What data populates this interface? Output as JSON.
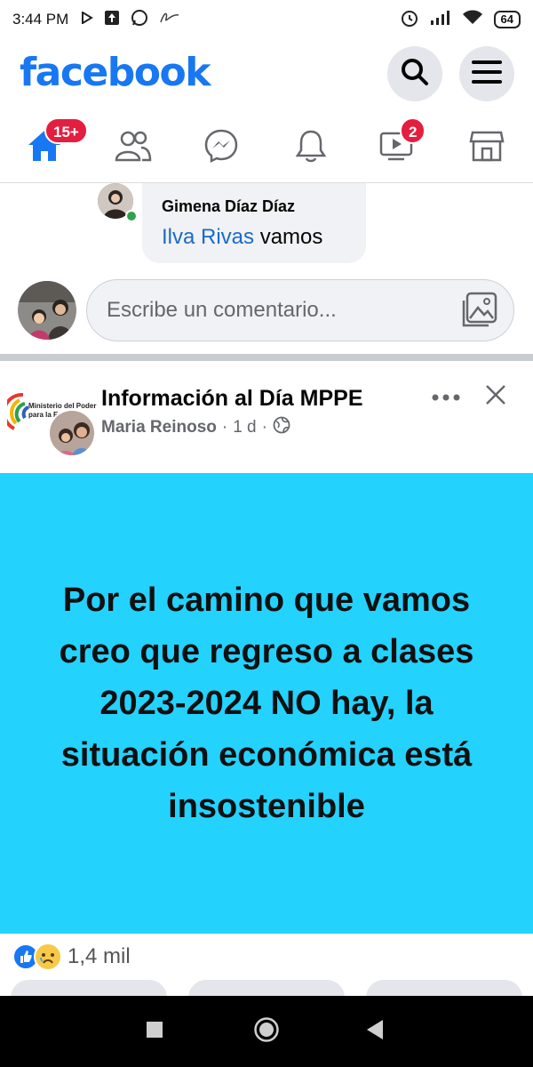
{
  "status_bar": {
    "time": "3:44 PM",
    "battery": "64"
  },
  "header": {
    "logo": "facebook"
  },
  "nav": {
    "home_badge": "15+",
    "watch_badge": "2"
  },
  "comment": {
    "author": "Gimena Díaz Díaz",
    "mention": "Ilva Rivas",
    "text": " vamos",
    "input_placeholder": "Escribe un comentario..."
  },
  "post": {
    "page_name": "Información al Día MPPE",
    "author": "Maria Reinoso",
    "time": "1 d",
    "logo_text_1": "Ministerio del Poder",
    "logo_text_2": "para la E",
    "body_text": "Por el camino que vamos creo que regreso a clases 2023-2024 NO hay, la situación económica está insostenible",
    "reaction_count": "1,4 mil",
    "background_color": "#24d2fe"
  },
  "colors": {
    "brand": "#1877f2",
    "badge": "#e41e3f"
  }
}
